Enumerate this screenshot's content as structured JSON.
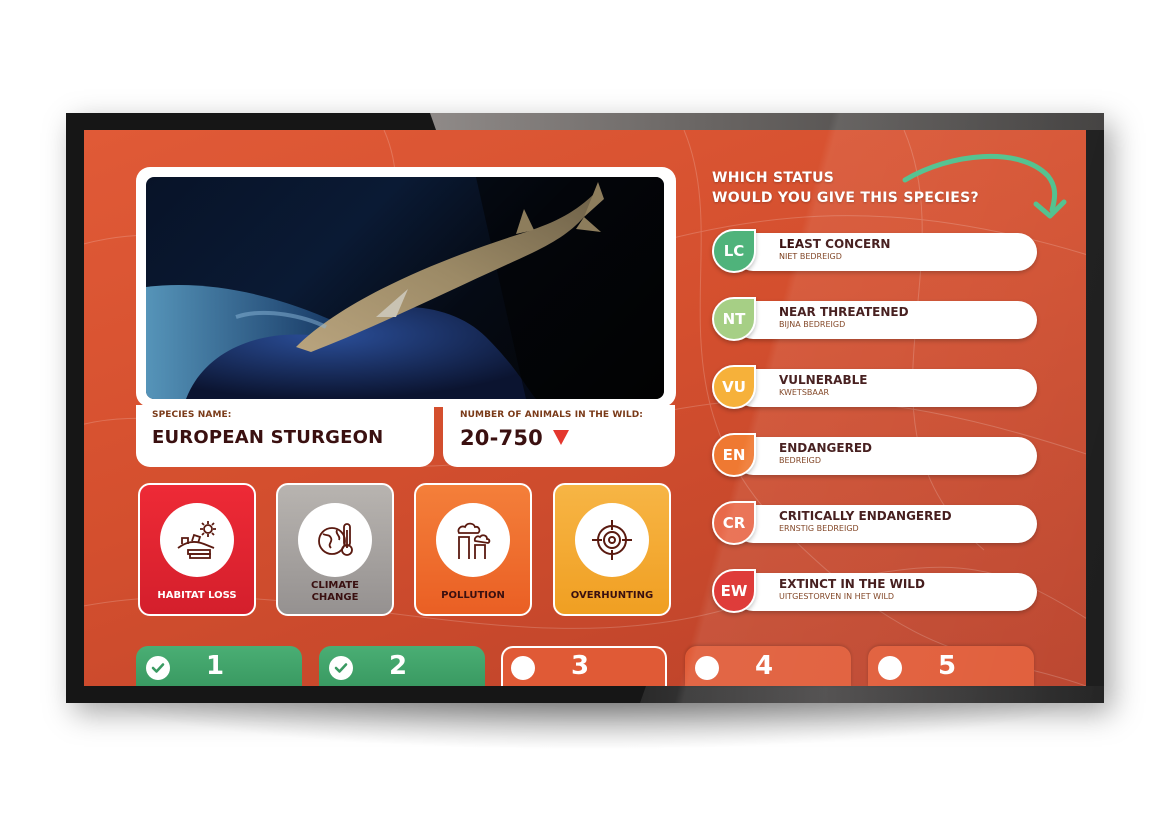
{
  "species": {
    "name_label": "SPECIES NAME:",
    "name": "EUROPEAN STURGEON",
    "count_label": "NUMBER OF ANIMALS IN THE WILD:",
    "count": "20-750",
    "trend": "decreasing",
    "photo_alt": "European sturgeon swimming over a rock"
  },
  "threats": [
    {
      "label": "HABITAT LOSS",
      "icon": "habitat-loss-icon",
      "color": "#e0232f",
      "text_color": "#ffffff"
    },
    {
      "label": "CLIMATE CHANGE",
      "icon": "globe-thermometer-icon",
      "color": "#a8a4a0",
      "text_color": "#3a1010"
    },
    {
      "label": "POLLUTION",
      "icon": "factory-smoke-icon",
      "color": "#ef6a2c",
      "text_color": "#3a1010"
    },
    {
      "label": "OVERHUNTING",
      "icon": "crosshair-icon",
      "color": "#f4a733",
      "text_color": "#3a1010"
    }
  ],
  "question": {
    "line1": "WHICH STATUS",
    "line2": "WOULD YOU GIVE THIS SPECIES?"
  },
  "statuses": [
    {
      "code": "LC",
      "title": "LEAST CONCERN",
      "subtitle": "NIET BEDREIGD",
      "color": "#4fb37b"
    },
    {
      "code": "NT",
      "title": "NEAR THREATENED",
      "subtitle": "BIJNA BEDREIGD",
      "color": "#a6cf85"
    },
    {
      "code": "VU",
      "title": "VULNERABLE",
      "subtitle": "KWETSBAAR",
      "color": "#f6b13a"
    },
    {
      "code": "EN",
      "title": "ENDANGERED",
      "subtitle": "BEDREIGD",
      "color": "#ef7932"
    },
    {
      "code": "CR",
      "title": "CRITICALLY ENDANGERED",
      "subtitle": "ERNSTIG BEDREIGD",
      "color": "#e8694a"
    },
    {
      "code": "EW",
      "title": "EXTINCT IN THE WILD",
      "subtitle": "UITGESTORVEN IN HET WILD",
      "color": "#dc2c2a"
    }
  ],
  "steps": [
    {
      "number": "1",
      "state": "completed"
    },
    {
      "number": "2",
      "state": "completed"
    },
    {
      "number": "3",
      "state": "current"
    },
    {
      "number": "4",
      "state": "pending"
    },
    {
      "number": "5",
      "state": "pending"
    }
  ],
  "colors": {
    "background": "#d9532f",
    "completed": "#3fa56c",
    "pending": "#e05a36",
    "text_dark": "#3a1010",
    "arrow": "#4bbf8a"
  }
}
